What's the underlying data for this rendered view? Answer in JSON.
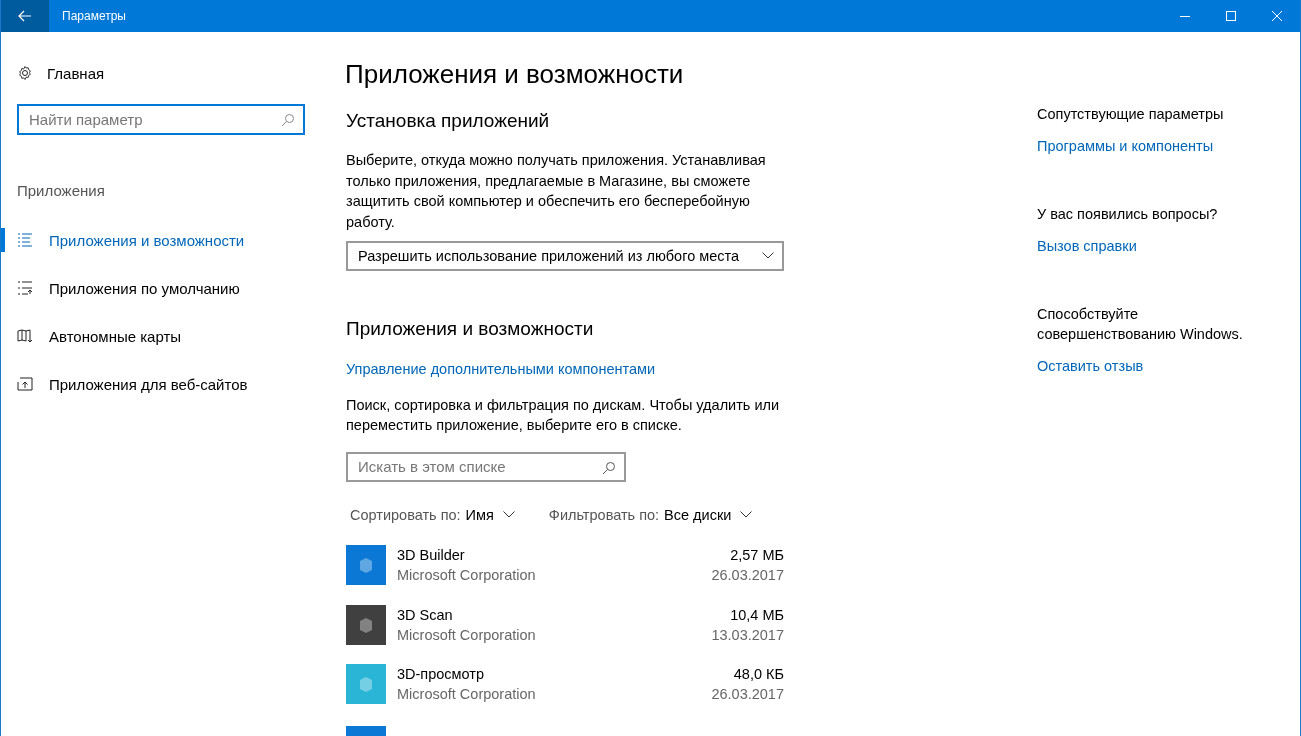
{
  "window": {
    "title": "Параметры"
  },
  "sidebar": {
    "home": "Главная",
    "search": {
      "placeholder": "Найти параметр"
    },
    "section": "Приложения",
    "items": [
      {
        "label": "Приложения и возможности",
        "kind": "list",
        "selected": true
      },
      {
        "label": "Приложения по умолчанию",
        "kind": "defaults",
        "selected": false
      },
      {
        "label": "Автономные карты",
        "kind": "map",
        "selected": false
      },
      {
        "label": "Приложения для веб-сайтов",
        "kind": "website",
        "selected": false
      }
    ]
  },
  "page_title": "Приложения и возможности",
  "install": {
    "heading": "Установка приложений",
    "description": "Выберите, откуда можно получать приложения. Устанавливая только приложения, предлагаемые в Магазине, вы сможете защитить свой компьютер и обеспечить его бесперебойную работу.",
    "dropdown": "Разрешить использование приложений из любого места"
  },
  "apps": {
    "heading": "Приложения и возможности",
    "link": "Управление дополнительными компонентами",
    "description": "Поиск, сортировка и фильтрация по дискам. Чтобы удалить или переместить приложение, выберите его в списке.",
    "search": {
      "placeholder": "Искать в этом списке"
    },
    "sort": {
      "label": "Сортировать по:",
      "value": "Имя"
    },
    "filter": {
      "label": "Фильтровать по:",
      "value": "Все диски"
    },
    "list": [
      {
        "name": "3D Builder",
        "publisher": "Microsoft Corporation",
        "size": "2,57 МБ",
        "date": "26.03.2017",
        "color": "#0a78d4"
      },
      {
        "name": "3D Scan",
        "publisher": "Microsoft Corporation",
        "size": "10,4 МБ",
        "date": "13.03.2017",
        "color": "#404040"
      },
      {
        "name": "3D-просмотр",
        "publisher": "Microsoft Corporation",
        "size": "48,0 КБ",
        "date": "26.03.2017",
        "color": "#2ab5d6"
      }
    ]
  },
  "related": [
    {
      "heading": "Сопутствующие параметры",
      "link": "Программы и компоненты"
    },
    {
      "heading": "У вас появились вопросы?",
      "link": "Вызов справки"
    },
    {
      "heading": "Способствуйте совершенствованию Windows.",
      "link": "Оставить отзыв"
    }
  ]
}
